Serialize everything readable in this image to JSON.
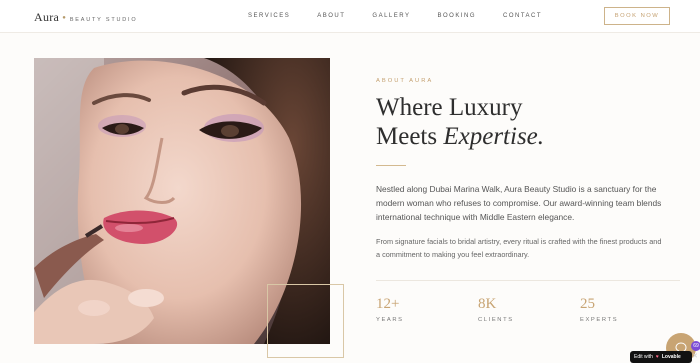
{
  "nav": {
    "brand": "Aura",
    "brand_sub": "BEAUTY STUDIO",
    "links": [
      "SERVICES",
      "ABOUT",
      "GALLERY",
      "BOOKING",
      "CONTACT"
    ],
    "cta": "BOOK NOW"
  },
  "about": {
    "eyebrow": "ABOUT AURA",
    "headline_line1": "Where Luxury",
    "headline_line2_plain": "Meets ",
    "headline_line2_em": "Expertise.",
    "para1": "Nestled along Dubai Marina Walk, Aura Beauty Studio is a sanctuary for the modern woman who refuses to compromise. Our award-winning team blends international technique with Middle Eastern elegance.",
    "para2": "From signature facials to bridal artistry, every ritual is crafted with the finest products and a commitment to making you feel extraordinary."
  },
  "stats": [
    {
      "value": "12+",
      "label": "YEARS"
    },
    {
      "value": "8K",
      "label": "CLIENTS"
    },
    {
      "value": "25",
      "label": "EXPERTS"
    }
  ],
  "widgets": {
    "badge_prefix": "Edit with",
    "badge_brand": "Lovable",
    "avatar_count": "69"
  },
  "colors": {
    "accent_gold": "#c8a473",
    "background": "#fdfcfa",
    "headline": "#2e2e2e"
  },
  "icons": [
    "chat-icon",
    "close-icon",
    "heart-logo-icon"
  ]
}
